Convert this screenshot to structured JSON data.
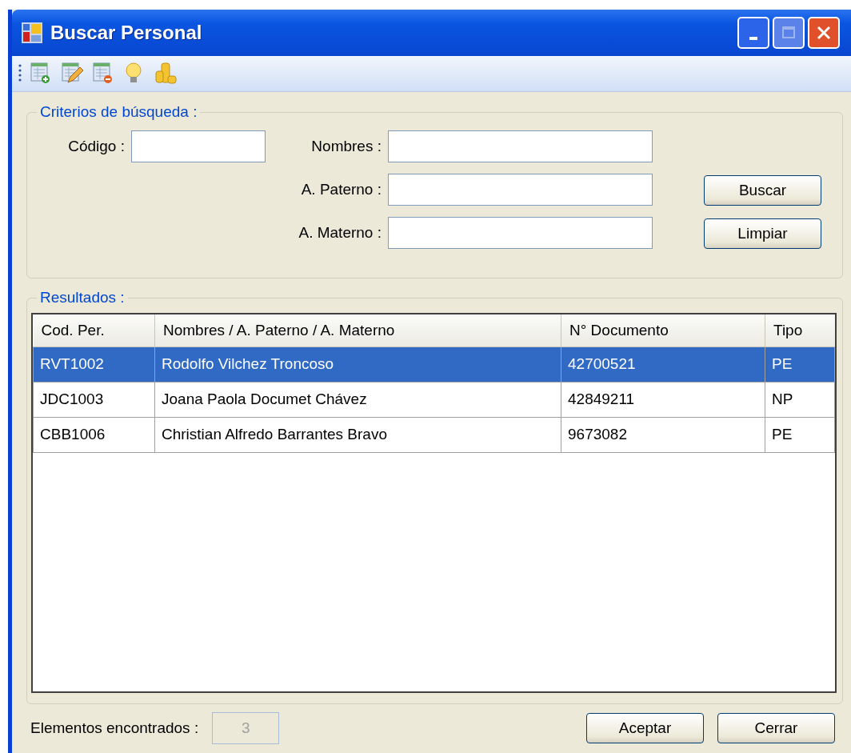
{
  "window": {
    "title": "Buscar Personal"
  },
  "toolbar": {
    "items": [
      {
        "kind": "add"
      },
      {
        "kind": "edit"
      },
      {
        "kind": "remove"
      },
      {
        "kind": "tip"
      },
      {
        "kind": "coins"
      }
    ]
  },
  "criteria": {
    "title": "Criterios de búsqueda :",
    "fields": [
      {
        "label": "Código :"
      },
      {
        "label": "Nombres :"
      },
      {
        "label": "A. Paterno :"
      },
      {
        "label": "A. Materno :"
      }
    ],
    "buttons": [
      "Buscar",
      "Limpiar"
    ]
  },
  "results": {
    "title": "Resultados :",
    "columns": [
      "Cod. Per.",
      "Nombres / A. Paterno / A. Materno",
      "N° Documento",
      "Tipo"
    ],
    "rows": [
      {
        "cells": [
          "RVT1002",
          "Rodolfo Vilchez Troncoso",
          "42700521",
          "PE"
        ],
        "selected": true
      },
      {
        "cells": [
          "JDC1003",
          "Joana Paola Documet Chávez",
          "42849211",
          "NP"
        ],
        "selected": false
      },
      {
        "cells": [
          "CBB1006",
          "Christian Alfredo Barrantes Bravo",
          "9673082",
          "PE"
        ],
        "selected": false
      }
    ]
  },
  "footer": {
    "count_label": "Elementos encontrados :",
    "count": {
      "value": "3",
      "disabled": true
    },
    "buttons": [
      "Aceptar",
      "Cerrar"
    ]
  }
}
